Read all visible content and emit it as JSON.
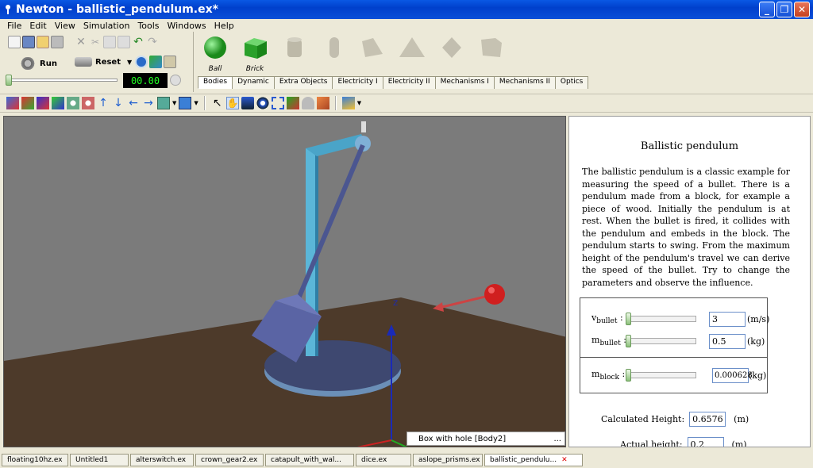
{
  "window": {
    "title": "Newton - ballistic_pendulum.ex*",
    "min": "_",
    "max": "❐",
    "close": "✕"
  },
  "menu": [
    "File",
    "Edit",
    "View",
    "Simulation",
    "Tools",
    "Windows",
    "Help"
  ],
  "sim": {
    "run_label": "Run",
    "reset_label": "Reset",
    "timer": "00.00",
    "progress": 0
  },
  "palette": {
    "objects": [
      {
        "label": "Ball",
        "active": true
      },
      {
        "label": "Brick",
        "active": true
      },
      {
        "label": "",
        "active": false
      },
      {
        "label": "",
        "active": false
      },
      {
        "label": "",
        "active": false
      },
      {
        "label": "",
        "active": false
      },
      {
        "label": "",
        "active": false
      },
      {
        "label": "",
        "active": false
      }
    ],
    "tabs": [
      "Bodies",
      "Dynamic",
      "Extra Objects",
      "Electricity I",
      "Electricity II",
      "Mechanisms I",
      "Mechanisms II",
      "Optics"
    ],
    "active_tab": 0
  },
  "viewport": {
    "axis_label": "Z",
    "status": "Box with hole [Body2]",
    "status_more": "..."
  },
  "panel": {
    "title": "Ballistic pendulum",
    "description": "The ballistic pendulum is a classic example for measuring the speed of a bullet. There is a pendulum made from a block, for example a piece of wood. Initially the pendulum is at rest. When the bullet is fired, it collides with the pendulum and embeds in the block. The pendulum starts to swing. From the maximum height of the pendulum's travel we can derive the speed of the bullet. Try to change the parameters and observe the influence.",
    "params": [
      {
        "var": "v",
        "sub": "bullet",
        "value": "3",
        "unit": "(m/s)"
      },
      {
        "var": "m",
        "sub": "bullet",
        "value": "0.5",
        "unit": "(kg)"
      },
      {
        "var": "m",
        "sub": "block",
        "value": "0.000628",
        "unit": "(kg)"
      }
    ],
    "calc_label": "Calculated Height:",
    "calc_value": "0.6576",
    "calc_unit": "(m)",
    "actual_label": "Actual height:",
    "actual_value": "0.2",
    "actual_unit": "(m)"
  },
  "files": [
    {
      "label": "floating10hz.ex"
    },
    {
      "label": "Untitled1"
    },
    {
      "label": "alterswitch.ex"
    },
    {
      "label": "crown_gear2.ex"
    },
    {
      "label": "catapult_with_wal..."
    },
    {
      "label": "dice.ex"
    },
    {
      "label": "aslope_prisms.ex"
    },
    {
      "label": "ballistic_pendulu...",
      "active": true,
      "close": "✕"
    }
  ]
}
